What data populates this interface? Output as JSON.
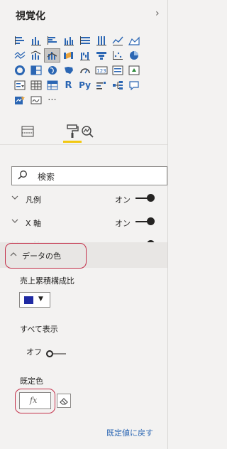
{
  "pane": {
    "title": "視覚化",
    "collapse_icon": "chevron-right-icon"
  },
  "visuals": {
    "selected_index": 14,
    "icons": [
      "stacked-bar-chart-icon",
      "stacked-column-chart-icon",
      "clustered-bar-chart-icon",
      "clustered-column-chart-icon",
      "100-percent-stacked-bar-chart-icon",
      "100-percent-stacked-column-chart-icon",
      "line-chart-icon",
      "area-chart-icon",
      "stacked-area-chart-icon",
      "line-and-stacked-column-chart-icon",
      "line-and-clustered-column-chart-icon",
      "ribbon-chart-icon",
      "waterfall-chart-icon",
      "funnel-chart-icon",
      "scatter-chart-icon",
      "pie-chart-icon",
      "donut-chart-icon",
      "treemap-icon",
      "map-icon",
      "filled-map-icon",
      "gauge-icon",
      "card-icon",
      "multi-row-card-icon",
      "kpi-icon",
      "slicer-icon",
      "table-icon",
      "matrix-icon",
      "r-script-visual-icon",
      "python-visual-icon",
      "key-influencers-icon",
      "decomposition-tree-icon",
      "qa-visual-icon",
      "smart-narrative-icon",
      "paginated-report-icon",
      "more-visuals-icon"
    ],
    "text_glyphs": {
      "card": "123",
      "r": "R",
      "py": "Py",
      "more": "···"
    }
  },
  "tabs": {
    "fields_icon": "fields-icon",
    "format_icon": "paint-roller-icon",
    "analytics_icon": "analytics-icon",
    "active": "format"
  },
  "search": {
    "placeholder": "検索",
    "icon": "search-icon"
  },
  "sections": [
    {
      "label": "凡例",
      "state": "オン",
      "expanded": false
    },
    {
      "label": "X 軸",
      "state": "オン",
      "expanded": false
    },
    {
      "label": "Y 軸",
      "state": "オン",
      "expanded": false
    }
  ],
  "data_colors": {
    "label": "データの色",
    "expanded": true,
    "series_label": "売上累積構成比",
    "series_color": "#1f2aa3",
    "show_all_label": "すべて表示",
    "show_all_state": "オフ",
    "default_color_label": "既定色",
    "fx_label": "fx",
    "reset_label": "既定値に戻す"
  },
  "colors": {
    "accent": "#f2c811",
    "link": "#2b66b3",
    "highlight": "#c4314b"
  }
}
